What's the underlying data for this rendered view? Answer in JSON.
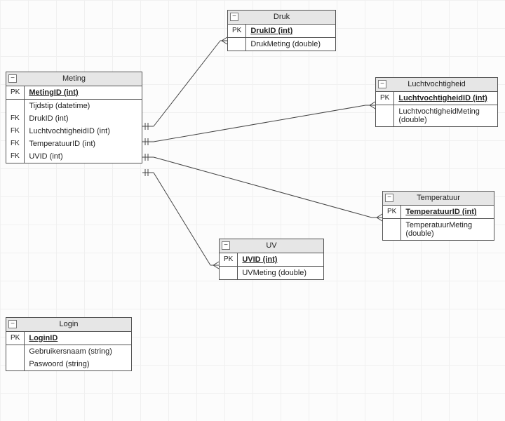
{
  "entities": {
    "meting": {
      "title": "Meting",
      "rows": [
        {
          "key": "PK",
          "label": "MetingID (int)",
          "pk": true
        },
        {
          "key": "",
          "label": "Tijdstip (datetime)"
        },
        {
          "key": "FK",
          "label": "DrukID (int)"
        },
        {
          "key": "FK",
          "label": "LuchtvochtigheidID (int)"
        },
        {
          "key": "FK",
          "label": "TemperatuurID (int)"
        },
        {
          "key": "FK",
          "label": "UVID (int)"
        }
      ]
    },
    "druk": {
      "title": "Druk",
      "rows": [
        {
          "key": "PK",
          "label": "DrukID (int)",
          "pk": true
        },
        {
          "key": "",
          "label": "DrukMeting (double)"
        }
      ]
    },
    "luchtvochtigheid": {
      "title": "Luchtvochtigheid",
      "rows": [
        {
          "key": "PK",
          "label": "LuchtvochtigheidID (int)",
          "pk": true
        },
        {
          "key": "",
          "label": "LuchtvochtigheidMeting (double)"
        }
      ]
    },
    "temperatuur": {
      "title": "Temperatuur",
      "rows": [
        {
          "key": "PK",
          "label": "TemperatuurID (int)",
          "pk": true
        },
        {
          "key": "",
          "label": "TemperatuurMeting (double)"
        }
      ]
    },
    "uv": {
      "title": "UV",
      "rows": [
        {
          "key": "PK",
          "label": "UVID (int)",
          "pk": true
        },
        {
          "key": "",
          "label": "UVMeting (double)"
        }
      ]
    },
    "login": {
      "title": "Login",
      "rows": [
        {
          "key": "PK",
          "label": "LoginID",
          "pk": true
        },
        {
          "key": "",
          "label": "Gebruikersnaam (string)"
        },
        {
          "key": "",
          "label": "Paswoord (string)"
        }
      ]
    }
  },
  "collapse_glyph": "−"
}
